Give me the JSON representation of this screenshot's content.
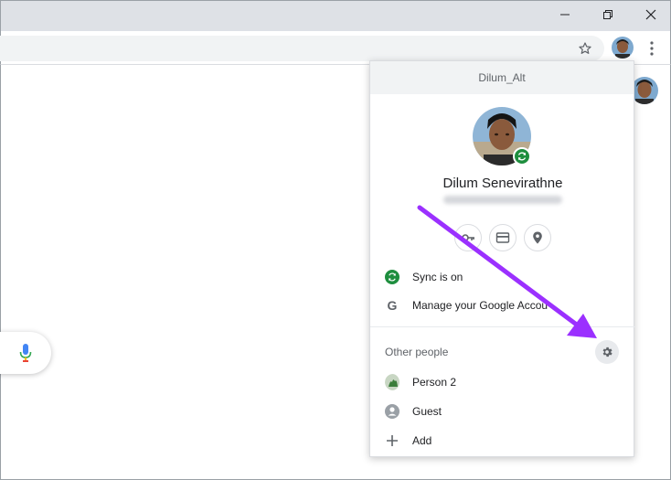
{
  "window": {
    "controls": [
      "minimize",
      "restore",
      "close"
    ]
  },
  "profile_menu": {
    "header_title": "Dilum_Alt",
    "name": "Dilum Senevirathne",
    "email": "",
    "quick_actions": [
      "passwords",
      "payment-methods",
      "addresses"
    ],
    "sync_label": "Sync is on",
    "manage_account_label": "Manage your Google Accou",
    "other_people_label": "Other people",
    "people": [
      {
        "name": "Person 2",
        "icon": "person2-avatar"
      },
      {
        "name": "Guest",
        "icon": "guest-icon"
      }
    ],
    "add_label": "Add"
  },
  "colors": {
    "accent_sync_green": "#1e8e3e",
    "annotation_arrow": "#9b30ff",
    "titlebar": "#dee1e6"
  }
}
